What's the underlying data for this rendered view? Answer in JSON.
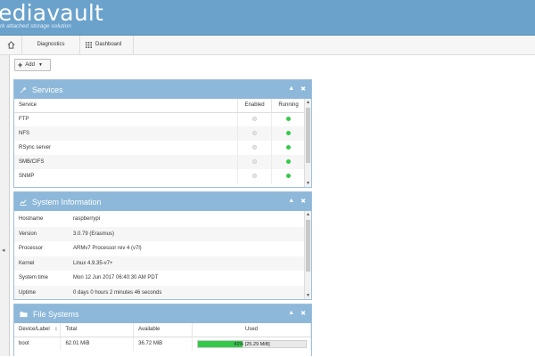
{
  "header": {
    "logo": "ediavault",
    "tagline": "rk attached storage solution"
  },
  "nav": {
    "diagnostics": "Diagnostics",
    "dashboard": "Dashboard"
  },
  "toolbar": {
    "add_label": "Add"
  },
  "services": {
    "title": "Services",
    "columns": [
      "Service",
      "Enabled",
      "Running"
    ],
    "rows": [
      {
        "name": "FTP",
        "enabled": false,
        "running": true
      },
      {
        "name": "NFS",
        "enabled": false,
        "running": true
      },
      {
        "name": "RSync server",
        "enabled": false,
        "running": true
      },
      {
        "name": "SMB/CIFS",
        "enabled": false,
        "running": true
      },
      {
        "name": "SNMP",
        "enabled": false,
        "running": true
      }
    ]
  },
  "system_info": {
    "title": "System Information",
    "rows": [
      {
        "key": "Hostname",
        "value": "raspberrypi"
      },
      {
        "key": "Version",
        "value": "3.0.79 (Erasmus)"
      },
      {
        "key": "Processor",
        "value": "ARMv7 Processor rev 4 (v7l)"
      },
      {
        "key": "Kernel",
        "value": "Linux 4.9.35-v7+"
      },
      {
        "key": "System time",
        "value": "Mon 12 Jun 2017 06:40:30 AM PDT"
      },
      {
        "key": "Uptime",
        "value": "0 days 0 hours 2 minutes 46 seconds"
      }
    ]
  },
  "filesystems": {
    "title": "File Systems",
    "columns": [
      "Device/Label",
      "Total",
      "Available",
      "Used"
    ],
    "rows": [
      {
        "device": "boot",
        "total": "62.01 MiB",
        "available": "36.72 MiB",
        "used_percent": 41,
        "used_text": "41% [25.29 MiB]"
      }
    ]
  },
  "colors": {
    "accent": "#6aa2cc",
    "widget_header": "#8db8d9",
    "running": "#35c94a"
  }
}
